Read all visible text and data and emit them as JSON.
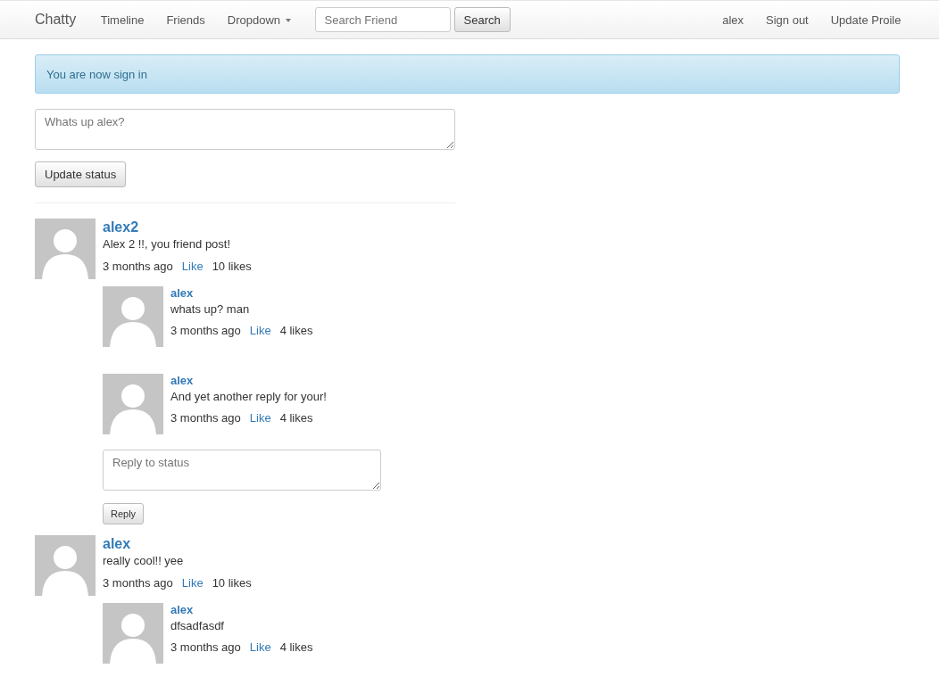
{
  "navbar": {
    "brand": "Chatty",
    "links": [
      {
        "label": "Timeline",
        "kind": "link"
      },
      {
        "label": "Friends",
        "kind": "link"
      },
      {
        "label": "Dropdown",
        "kind": "dropdown"
      }
    ],
    "search": {
      "placeholder": "Search Friend",
      "button": "Search"
    },
    "right_links": [
      "alex",
      "Sign out",
      "Update Proile"
    ]
  },
  "alert": "You are now sign in",
  "status_form": {
    "placeholder": "Whats up alex?",
    "button": "Update status"
  },
  "posts": [
    {
      "author": "alex2",
      "text": "Alex 2 !!, you friend post!",
      "time": "3 months ago",
      "like": "Like",
      "likes": "10 likes",
      "replies": [
        {
          "author": "alex",
          "text": "whats up? man",
          "time": "3 months ago",
          "like": "Like",
          "likes": "4 likes"
        },
        {
          "author": "alex",
          "text": "And yet another reply for your!",
          "time": "3 months ago",
          "like": "Like",
          "likes": "4 likes"
        }
      ],
      "reply_form": {
        "placeholder": "Reply to status",
        "button": "Reply"
      }
    },
    {
      "author": "alex",
      "text": "really cool!! yee",
      "time": "3 months ago",
      "like": "Like",
      "likes": "10 likes",
      "replies": [
        {
          "author": "alex",
          "text": "dfsadfasdf",
          "time": "3 months ago",
          "like": "Like",
          "likes": "4 likes"
        }
      ]
    }
  ]
}
